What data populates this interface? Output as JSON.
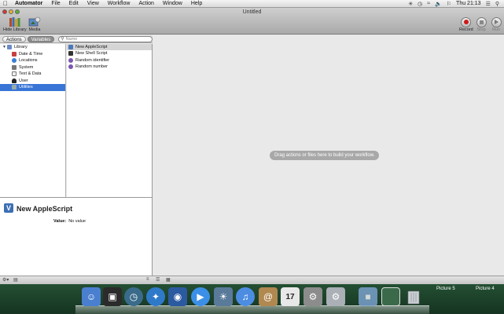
{
  "menubar": {
    "apple_glyph": "",
    "items": [
      "Automator",
      "File",
      "Edit",
      "View",
      "Workflow",
      "Action",
      "Window",
      "Help"
    ],
    "clock": "Thu 21:13"
  },
  "window": {
    "title": "Untitled"
  },
  "toolbar": {
    "hide_library": "Hide Library",
    "media": "Media",
    "record": "Record",
    "stop": "Stop",
    "run": "Run"
  },
  "library_header": {
    "actions_tab": "Actions",
    "variables_tab": "Variables",
    "search_placeholder": "Name"
  },
  "tree": {
    "root": "Library",
    "children": [
      "Date & Time",
      "Locations",
      "System",
      "Text & Data",
      "User",
      "Utilities"
    ],
    "selected": "Utilities"
  },
  "actions": {
    "items": [
      "New AppleScript",
      "New Shell Script",
      "Random identifier",
      "Random number"
    ],
    "selected": "New AppleScript"
  },
  "description": {
    "title": "New AppleScript",
    "value_label": "Value:",
    "value_text": "No value"
  },
  "workflow": {
    "drop_hint": "Drag actions or files here to build your workflow."
  },
  "dock": {
    "calendar_day": "17",
    "picture_labels": [
      "Picture 5",
      "Picture 4"
    ],
    "colors": {
      "finder": "#4a7fd0",
      "dashboard": "#2b2b2b",
      "timemachine": "#3a6b8a",
      "safari": "#2f79c9",
      "preview": "#2c5aa0",
      "ichat": "#3b8fe6",
      "iphoto": "#5a7a9a",
      "itunes": "#4c8de2",
      "addressbook": "#b08850",
      "ical": "#e8e8e8",
      "sysprefs": "#8c8c8c",
      "automator": "#aab0b6",
      "folder": "#7fa6d6",
      "trash": "#9aa"
    }
  }
}
